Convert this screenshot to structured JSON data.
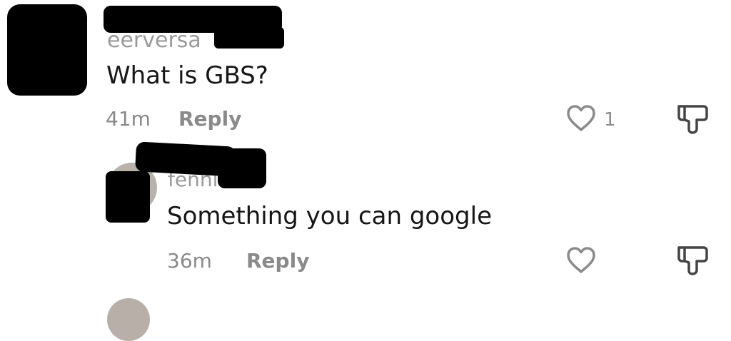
{
  "comments": [
    {
      "username": "eerversa",
      "text": "What is GBS?",
      "time": "41m",
      "reply_label": "Reply",
      "like_count": "1"
    },
    {
      "username": "fennite",
      "text": "Something you can google",
      "time": "36m",
      "reply_label": "Reply",
      "like_count": ""
    }
  ],
  "icons": {
    "like": "heart-outline-icon",
    "dislike": "thumbs-down-icon"
  },
  "colors": {
    "text": "#161616",
    "muted": "#8a8a8a",
    "redaction": "#000000"
  }
}
